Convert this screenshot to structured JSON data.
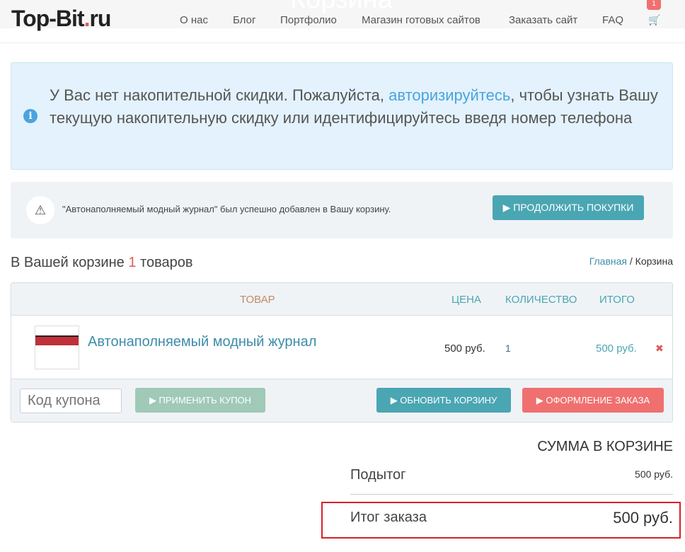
{
  "header": {
    "page_title": "Корзина",
    "logo_main": "Top-Bit",
    "logo_dot": ".",
    "logo_tld": "ru",
    "nav": [
      "О нас",
      "Блог",
      "Портфолио",
      "Магазин готовых сайтов",
      "Заказать сайт",
      "FAQ"
    ],
    "cart_count": "1",
    "cart_icon": "cart-icon"
  },
  "info": {
    "text1": "У Вас нет накопительной скидки. Пожалуйста, ",
    "link": "авторизируйтесь",
    "text2": ", чтобы узнать Вашу текущую накопительную скидку или идентифицируйтесь введя номер телефона",
    "icon": "info-icon"
  },
  "notice": {
    "message": "\"Автонаполняемый модный журнал\" был успешно добавлен в Вашу корзину.",
    "button": "▶ ПРОДОЛЖИТЬ ПОКУПКИ",
    "icon": "warning-icon"
  },
  "cart": {
    "count_prefix": "В Вашей корзине ",
    "count": "1",
    "count_suffix": " товаров",
    "breadcrumb_home": "Главная",
    "breadcrumb_sep": " / ",
    "breadcrumb_current": "Корзина",
    "headers": {
      "product": "ТОВАР",
      "price": "ЦЕНА",
      "qty": "КОЛИЧЕСТВО",
      "total": "ИТОГО"
    },
    "items": [
      {
        "name": "Автонаполняемый модный журнал",
        "price": "500 руб.",
        "qty": "1",
        "total": "500 руб.",
        "remove": "✖"
      }
    ],
    "coupon_placeholder": "Код купона",
    "apply": "▶ ПРИМЕНИТЬ КУПОН",
    "update": "▶ ОБНОВИТЬ КОРЗИНУ",
    "checkout": "▶ ОФОРМЛЕНИЕ ЗАКАЗА"
  },
  "totals": {
    "title": "СУММА В КОРЗИНЕ",
    "subtotal_label": "Подытог",
    "subtotal": "500 руб.",
    "total_label": "Итог заказа",
    "total": "500 руб."
  }
}
